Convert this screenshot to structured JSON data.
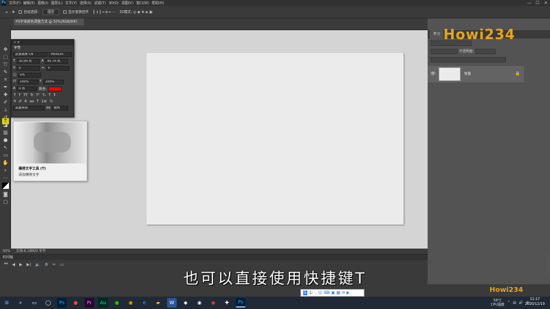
{
  "menubar": {
    "items": [
      "文件(F)",
      "编辑(E)",
      "图像(I)",
      "图层(L)",
      "文字(Y)",
      "选择(S)",
      "滤镜(T)",
      "3D(D)",
      "视图(V)",
      "窗口(W)",
      "帮助(H)"
    ],
    "min": "—",
    "max": "☐",
    "close": "✕"
  },
  "options": {
    "auto_select": "自动选择:",
    "layer_select": "图层",
    "show_transform": "显示变换控件"
  },
  "doc_tab": "PS字体颜色调整方法 @ 50%(RGB/8#)",
  "status": {
    "zoom": "50%",
    "doc": "文档:6.18M/0 字节"
  },
  "timeline": {
    "title": "时间轴"
  },
  "char_panel": {
    "header": "字符",
    "font_family": "思源黑体 CN",
    "font_style": "Medium",
    "size": "35.09 点",
    "leading": "46.79 点",
    "kerning": "0",
    "tracking": "0",
    "scale_pct": "0%",
    "vscale": "100%",
    "hscale": "100%",
    "baseline": "0 点",
    "color_label": "颜色:",
    "color": "#ff0000",
    "language": "美国英语",
    "antialias": "锐利",
    "styles": [
      "T",
      "T",
      "TT",
      "Tr",
      "T¹",
      "T₁",
      "T",
      "Ŧ"
    ]
  },
  "tooltip": {
    "title": "横排文字工具 (T)",
    "desc": "添加横排文字"
  },
  "panel": {
    "tab": "学习",
    "kind": "正常",
    "opacity": "不透明度:",
    "layer_name": "背景"
  },
  "subtitle": "也可以直接使用快捷键T",
  "watermark": "Howi234",
  "tray": {
    "temp": "58°C",
    "cpu": "CPU温度",
    "time": "11:17",
    "date": "2020/12/19"
  },
  "ime": [
    "中",
    "·,",
    "☺",
    "⌨",
    "▣",
    "▦",
    "✉",
    "▶"
  ]
}
